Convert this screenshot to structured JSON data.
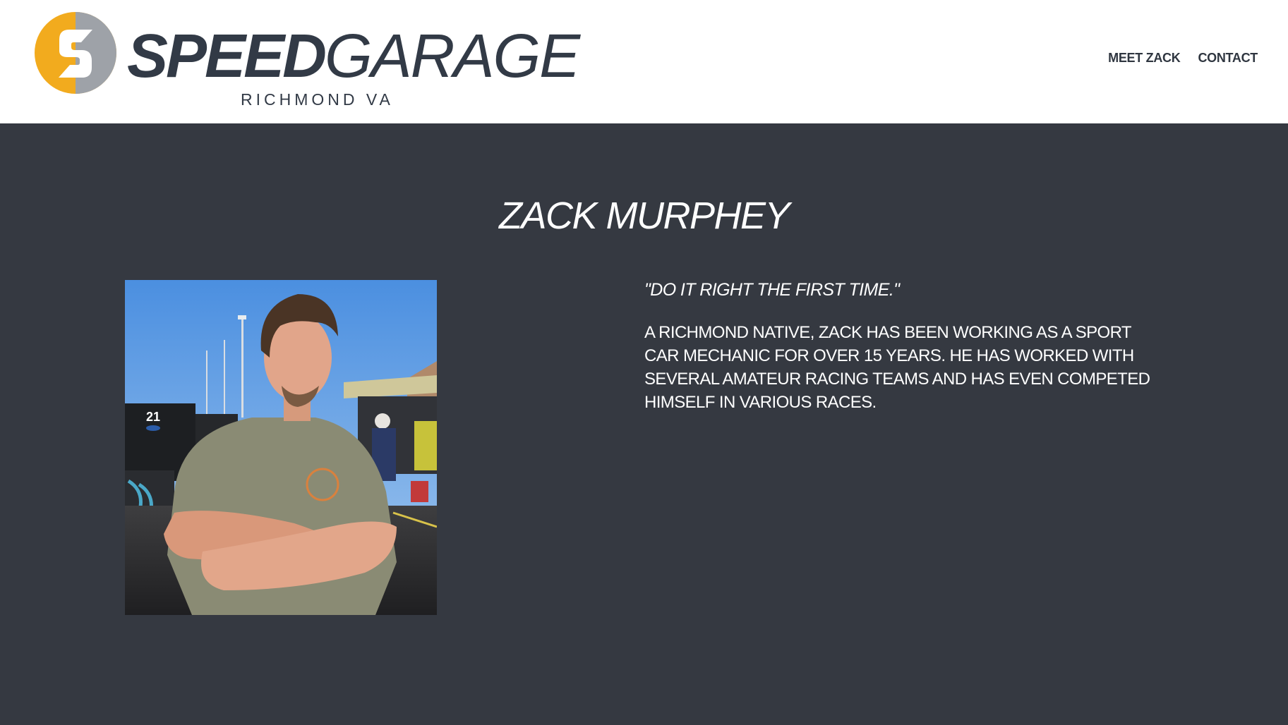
{
  "brand": {
    "name_bold": "SPEED",
    "name_light": "GARAGE",
    "location": "RICHMOND VA",
    "colors": {
      "orange": "#f2ab1e",
      "gray": "#9ea2a8",
      "dark": "#323a46"
    }
  },
  "nav": {
    "items": [
      {
        "label": "MEET ZACK"
      },
      {
        "label": "CONTACT"
      }
    ]
  },
  "profile": {
    "name": "ZACK MURPHEY",
    "quote": "\"DO IT RIGHT THE FIRST TIME.\"",
    "bio": "A RICHMOND NATIVE, ZACK HAS BEEN WORKING AS A SPORT CAR MECHANIC FOR OVER 15 YEARS. HE HAS WORKED WITH SEVERAL AMATEUR RACING TEAMS AND HAS EVEN COMPETED HIMSELF IN VARIOUS RACES.",
    "photo_text": "21"
  },
  "theme": {
    "header_bg": "#ffffff",
    "main_bg": "#353941",
    "text": "#ffffff"
  }
}
